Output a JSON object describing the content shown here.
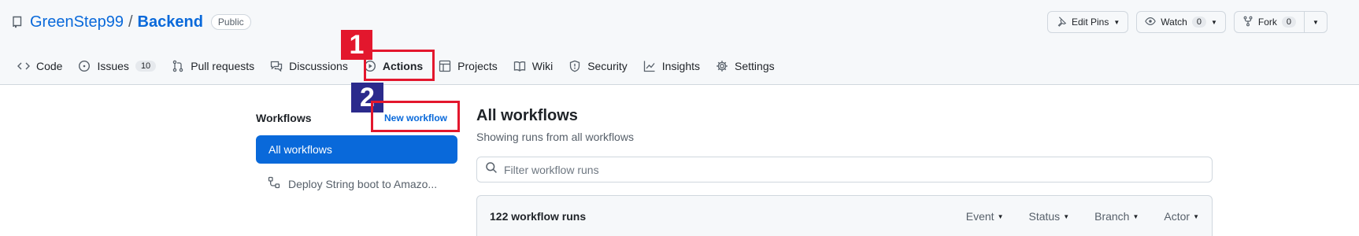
{
  "repo": {
    "owner": "GreenStep99",
    "separator": "/",
    "name": "Backend",
    "visibility": "Public"
  },
  "top_actions": {
    "edit_pins": "Edit Pins",
    "watch": "Watch",
    "watch_count": "0",
    "fork": "Fork",
    "fork_count": "0"
  },
  "nav": {
    "code": "Code",
    "issues": "Issues",
    "issues_count": "10",
    "pull_requests": "Pull requests",
    "discussions": "Discussions",
    "actions": "Actions",
    "projects": "Projects",
    "wiki": "Wiki",
    "security": "Security",
    "insights": "Insights",
    "settings": "Settings"
  },
  "annotations": {
    "one": "1",
    "two": "2",
    "color": "#e3172d"
  },
  "sidebar": {
    "title": "Workflows",
    "new_workflow": "New workflow",
    "all_workflows": "All workflows",
    "items": [
      {
        "label": "Deploy String boot to Amazo..."
      }
    ]
  },
  "main": {
    "title": "All workflows",
    "subtitle": "Showing runs from all workflows",
    "filter_placeholder": "Filter workflow runs",
    "runs_count": "122 workflow runs",
    "filters": {
      "event": "Event",
      "status": "Status",
      "branch": "Branch",
      "actor": "Actor"
    }
  },
  "colors": {
    "accent": "#0969da",
    "header_bg": "#f6f8fa"
  }
}
